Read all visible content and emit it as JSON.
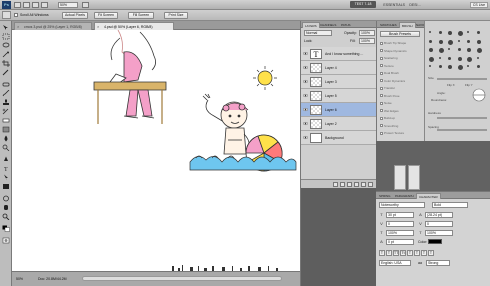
{
  "appbar": {
    "logo": "Ps",
    "zoom_value": "50%",
    "workspace_label": "TEST 7-18",
    "essentials_label": "ESSENTIALS",
    "design_label": "DESI…",
    "cs_live_label": "CS Live"
  },
  "options_bar": {
    "scroll_all_label": "Scroll All Windows",
    "actual_pixels_label": "Actual Pixels",
    "fit_screen_label": "Fit Screen",
    "fill_screen_label": "Fill Screen",
    "print_size_label": "Print Size"
  },
  "tabs": [
    {
      "label": "cmos 3.psd @ 25% (Layer 1, RGB/8)",
      "active": false
    },
    {
      "label": "4.psd @ 50% (Layer 6, RGB/8)",
      "active": true
    }
  ],
  "status": {
    "zoom": "50%",
    "doc": "Doc: 20.8M/44.2M"
  },
  "layers_panel": {
    "tabs": [
      "LAYERS",
      "CHANNELS",
      "PATHS"
    ],
    "blend_mode": "Normal",
    "opacity_label": "Opacity:",
    "opacity_value": "100%",
    "lock_label": "Lock:",
    "fill_label": "Fill:",
    "fill_value": "100%",
    "layers": [
      {
        "name": "And I know something ...",
        "type": "text",
        "selected": false
      },
      {
        "name": "Layer 4",
        "type": "pixel",
        "selected": false
      },
      {
        "name": "Layer 3",
        "type": "pixel",
        "selected": false
      },
      {
        "name": "Layer 5",
        "type": "pixel",
        "selected": false
      },
      {
        "name": "Layer 6",
        "type": "pixel",
        "selected": true
      },
      {
        "name": "Layer 2",
        "type": "pixel",
        "selected": false
      },
      {
        "name": "Background",
        "type": "white",
        "selected": false
      }
    ]
  },
  "brush_panel": {
    "tabs": [
      "SWATCHES",
      "BRUSH",
      "NAVIGATOR"
    ],
    "presets_button": "Brush Presets",
    "options": [
      "Brush Tip Shape",
      "Shape Dynamics",
      "Scattering",
      "Texture",
      "Dual Brush",
      "Color Dynamics",
      "Transfer",
      "Brush Pose",
      "Noise",
      "Wet Edges",
      "Build-up",
      "Smoothing",
      "Protect Texture"
    ],
    "size_label": "Size",
    "flip_x_label": "Flip X",
    "flip_y_label": "Flip Y",
    "angle_label": "Angle:",
    "roundness_label": "Roundness:",
    "hardness_label": "Hardness",
    "spacing_label": "Spacing"
  },
  "char_panel": {
    "tabs": [
      "SPRING",
      "PARAGRAPH",
      "CHARACTER"
    ],
    "font_family": "Noteworthy",
    "font_style": "Bold",
    "size": "30 pt",
    "leading": "(28.24 pt)",
    "kerning": "0",
    "tracking": "0",
    "vscale": "100%",
    "hscale": "100%",
    "baseline": "0 pt",
    "color_label": "Color:",
    "language": "English: USA",
    "antialias": "Strong",
    "aa_label": "aa"
  }
}
